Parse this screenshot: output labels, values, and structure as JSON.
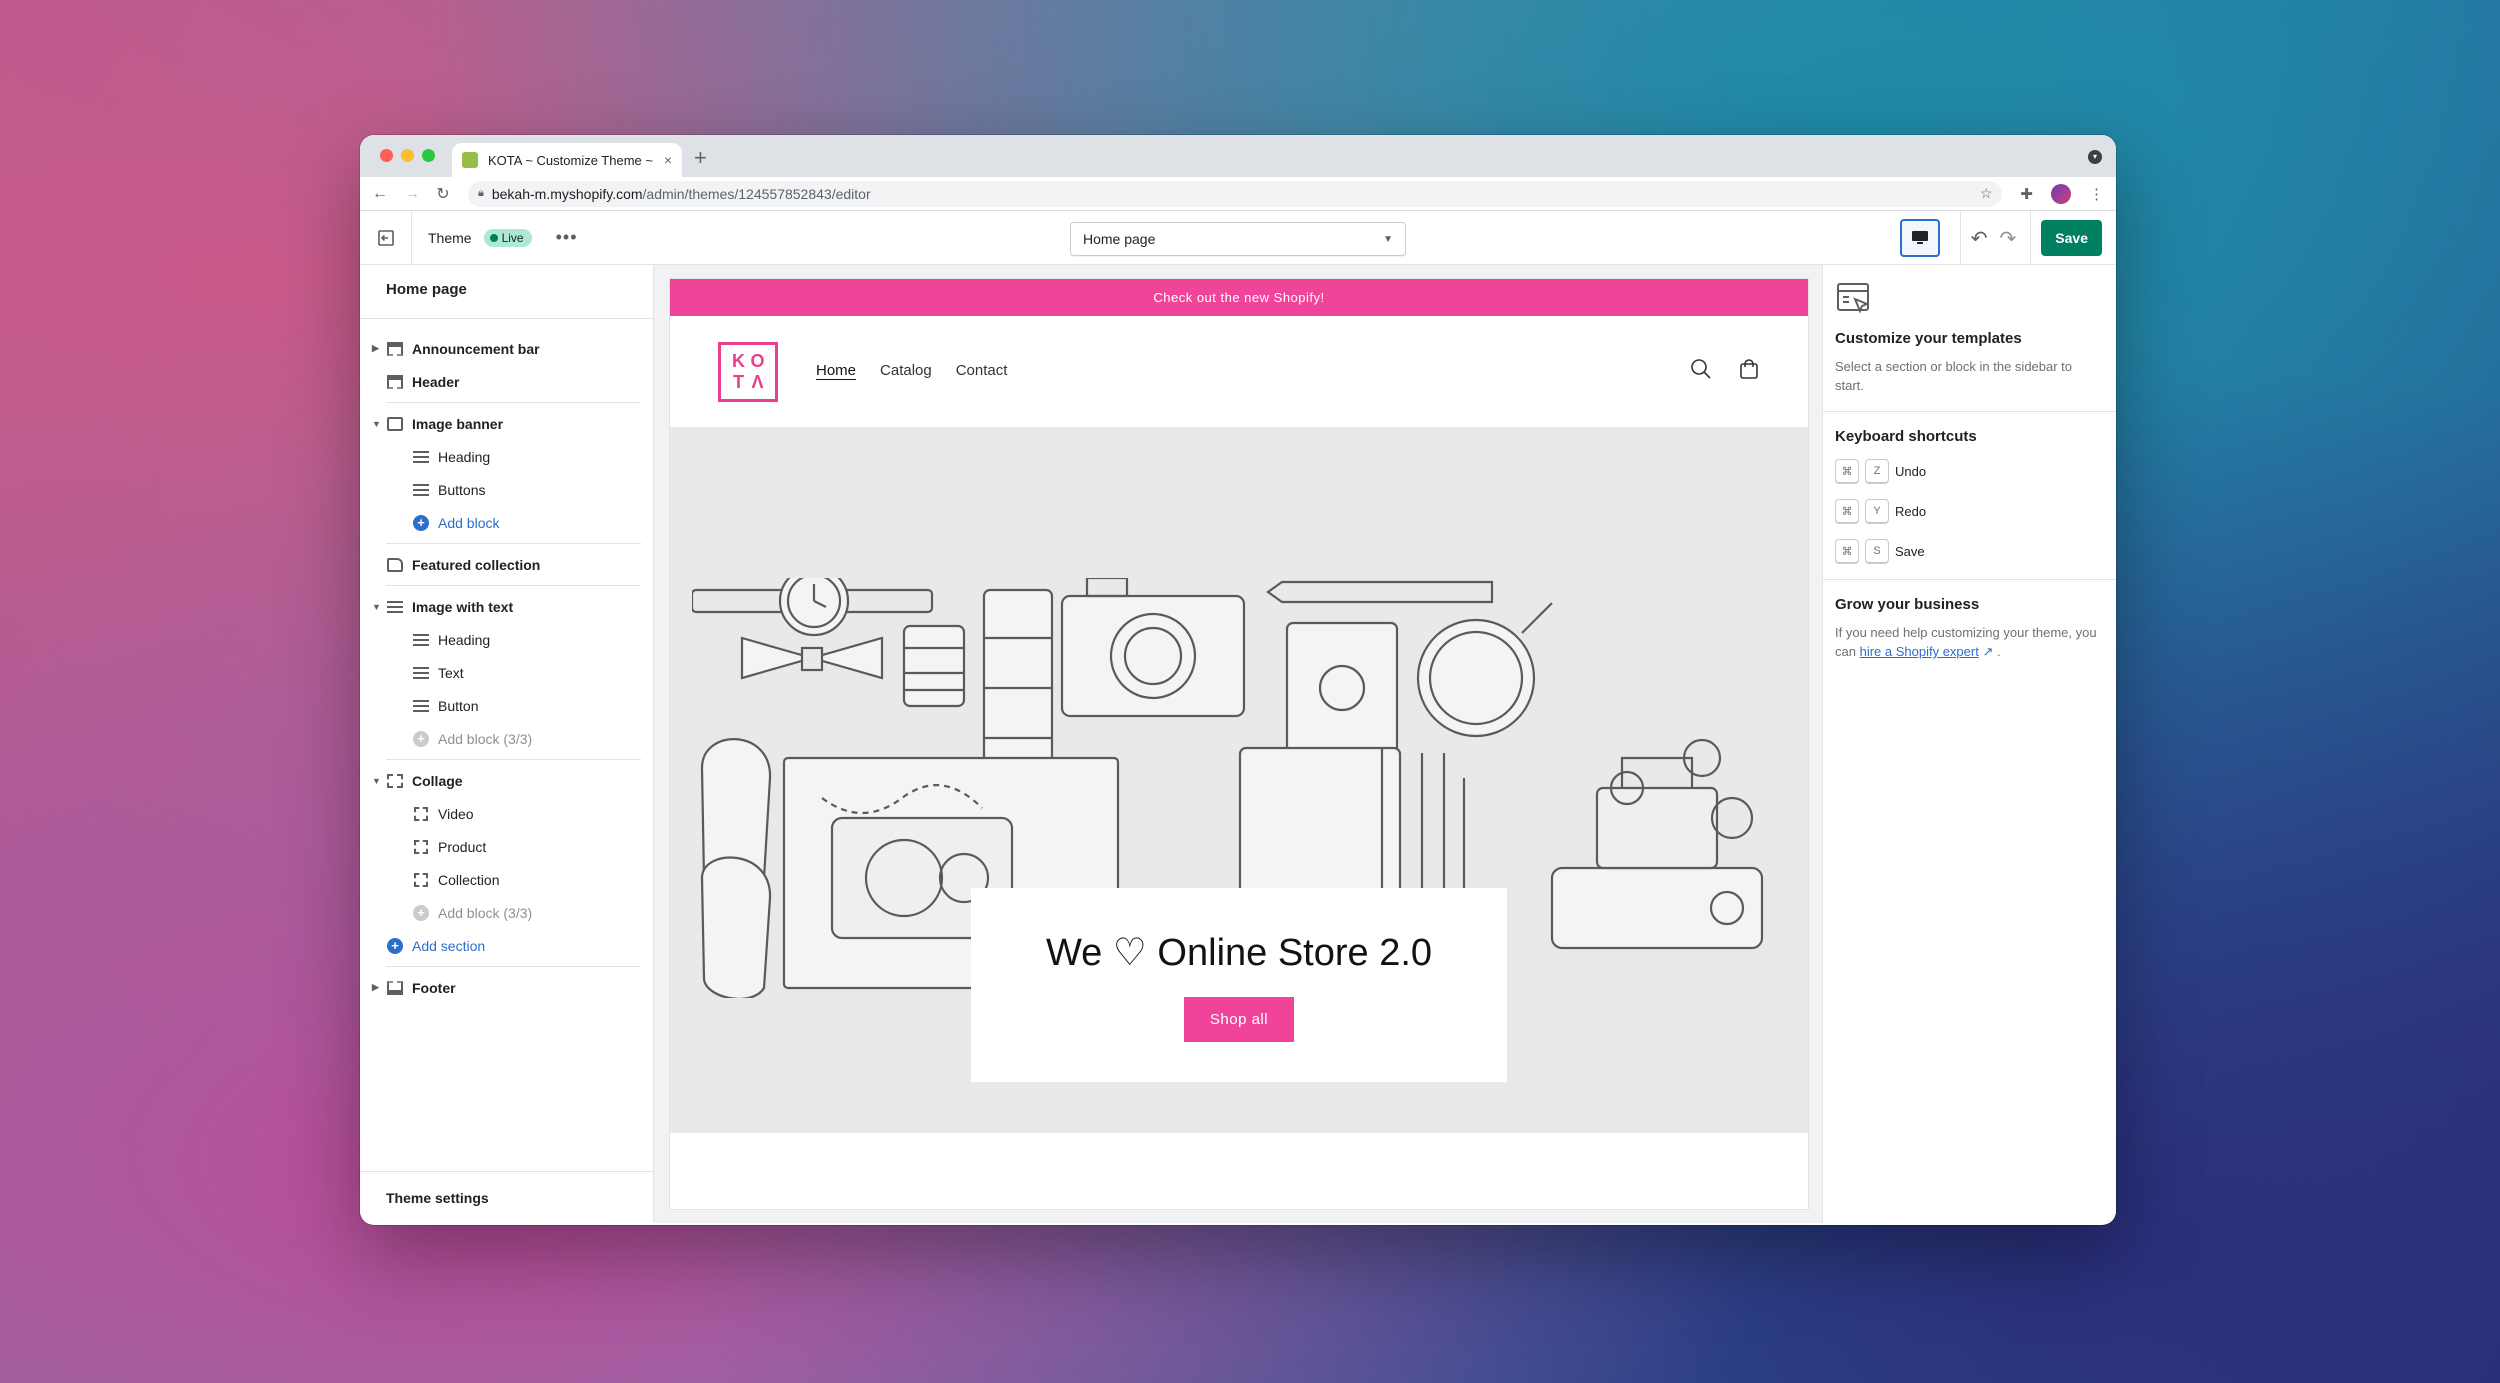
{
  "browser": {
    "tab_title": "KOTA ~ Customize Theme ~ Sh",
    "tab_close": "×",
    "new_tab": "+",
    "url_host": "bekah-m.myshopify.com",
    "url_path": "/admin/themes/124557852843/editor"
  },
  "app_header": {
    "theme_label": "Theme",
    "live_badge": "Live",
    "more": "•••",
    "page_select": "Home page",
    "save_label": "Save"
  },
  "sidebar": {
    "title": "Home page",
    "items": [
      {
        "label": "Announcement bar"
      },
      {
        "label": "Header"
      },
      {
        "label": "Image banner"
      },
      {
        "label": "Heading"
      },
      {
        "label": "Buttons"
      },
      {
        "label": "Add block"
      },
      {
        "label": "Featured collection"
      },
      {
        "label": "Image with text"
      },
      {
        "label": "Heading"
      },
      {
        "label": "Text"
      },
      {
        "label": "Button"
      },
      {
        "label": "Add block (3/3)"
      },
      {
        "label": "Collage"
      },
      {
        "label": "Video"
      },
      {
        "label": "Product"
      },
      {
        "label": "Collection"
      },
      {
        "label": "Add block (3/3)"
      },
      {
        "label": "Add section"
      },
      {
        "label": "Footer"
      }
    ],
    "footer": "Theme settings"
  },
  "preview": {
    "announcement": "Check out the new Shopify!",
    "logo_letters": [
      "K",
      "O",
      "T",
      "Λ"
    ],
    "nav": [
      "Home",
      "Catalog",
      "Contact"
    ],
    "hero_heading": "We ♡ Online Store 2.0",
    "hero_button": "Shop all"
  },
  "right_panel": {
    "customize_title": "Customize your templates",
    "customize_text": "Select a section or block in the sidebar to start.",
    "shortcuts_title": "Keyboard shortcuts",
    "shortcuts": [
      {
        "mod": "⌘",
        "key": "Z",
        "label": "Undo"
      },
      {
        "mod": "⌘",
        "key": "Y",
        "label": "Redo"
      },
      {
        "mod": "⌘",
        "key": "S",
        "label": "Save"
      }
    ],
    "grow_title": "Grow your business",
    "grow_text": "If you need help customizing your theme, you can",
    "grow_link": "hire a Shopify expert",
    "grow_end": "."
  },
  "colors": {
    "accent_pink": "#f0449a",
    "save_green": "#008060",
    "link_blue": "#2c6ecb"
  }
}
